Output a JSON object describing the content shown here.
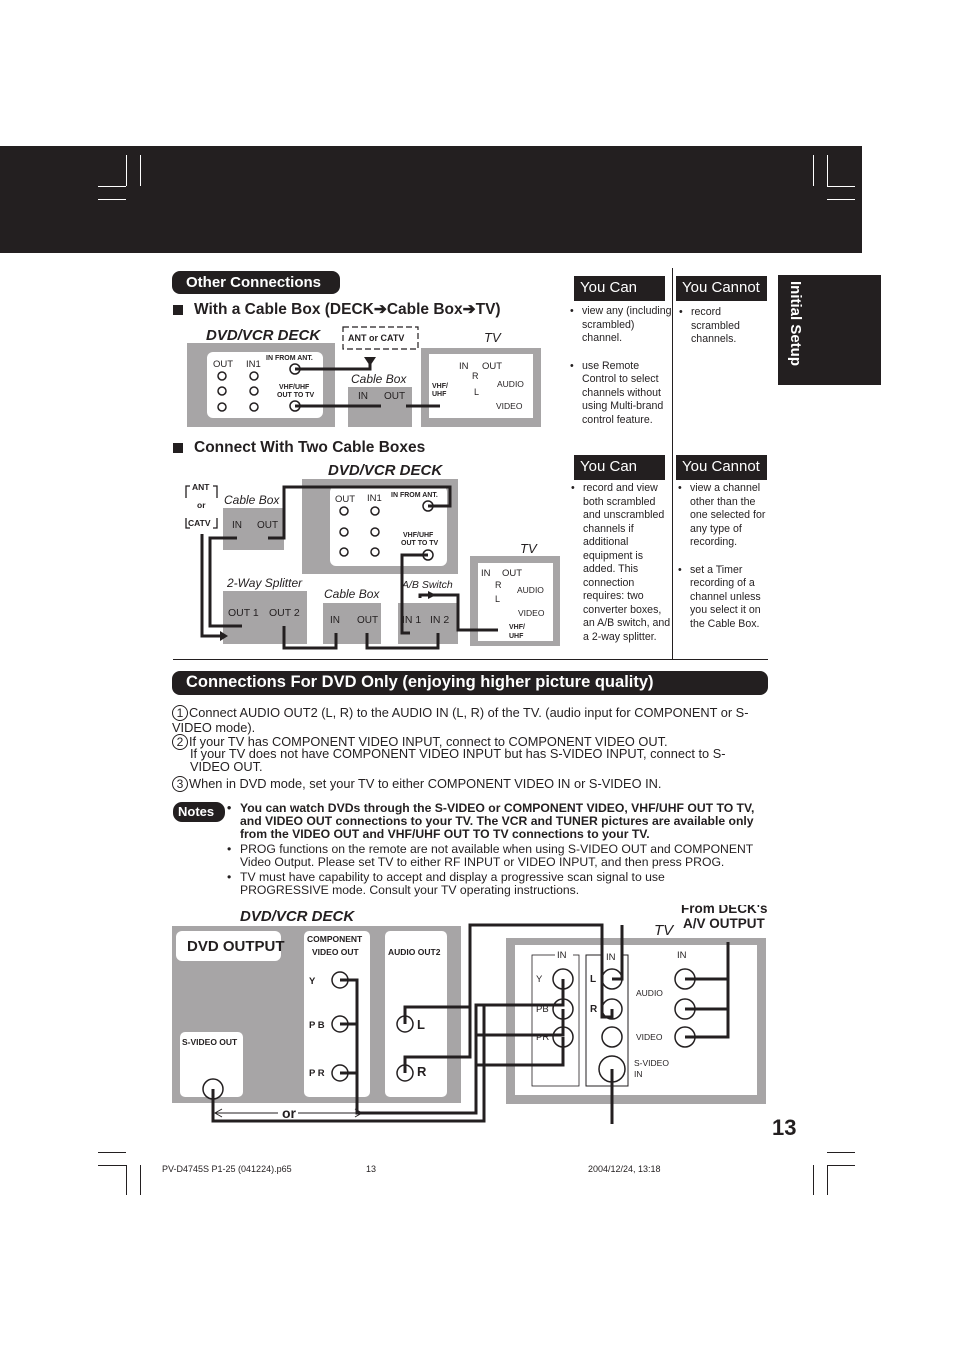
{
  "header": {
    "side_tab": "Initial Setup"
  },
  "section": {
    "title": "Other Connections",
    "cable_box": {
      "heading": "With a Cable Box (DECK➔Cable Box➔TV)",
      "deck_label": "DVD/VCR DECK",
      "tv_label": "TV",
      "ant_label": "ANT or CATV",
      "cable_box_label": "Cable  Box",
      "deck_ports": {
        "out": "OUT",
        "in1": "IN1",
        "in_from_ant": "IN FROM ANT.",
        "vhf_uhf_out_1": "VHF/UHF",
        "vhf_uhf_out_2": "OUT TO TV"
      },
      "cable_ports": {
        "in": "IN",
        "out": "OUT"
      },
      "tv_ports": {
        "vhf": "VHF/",
        "uhf": "UHF",
        "in": "IN",
        "out": "OUT",
        "r": "R",
        "l": "L",
        "audio": "AUDIO",
        "video": "VIDEO"
      },
      "you_can": {
        "title": "You Can",
        "items": [
          "view any (including scrambled) channel.",
          "use Remote Control to select channels without using Multi-brand control feature."
        ]
      },
      "you_cannot": {
        "title": "You Cannot",
        "items": [
          "record scrambled channels."
        ]
      }
    },
    "two_boxes": {
      "heading": "Connect With Two Cable Boxes",
      "deck_label": "DVD/VCR DECK",
      "tv_label": "TV",
      "ant_1": "ANT",
      "ant_2": "or",
      "ant_3": "CATV",
      "cable_box_label": "Cable  Box",
      "splitter_label": "2-Way  Splitter",
      "ab_switch_label": "A/B  Switch",
      "splitter_ports": {
        "out1": "OUT 1",
        "out2": "OUT 2"
      },
      "switch_ports": {
        "in1": "IN 1",
        "in2": "IN 2"
      },
      "you_can": {
        "title": "You Can",
        "items": [
          "record and view both scrambled and unscrambled channels if additional equipment is added. This connection requires: two converter boxes, an A/B switch, and a 2-way splitter."
        ]
      },
      "you_cannot": {
        "title": "You Cannot",
        "items": [
          "view a channel other than the one selected for any type of recording.",
          "set a Timer recording of a channel unless you select it on the Cable Box."
        ]
      }
    }
  },
  "dvd_only": {
    "title": "Connections For DVD Only (enjoying higher picture quality)",
    "steps": [
      {
        "num": "1",
        "text": "Connect AUDIO OUT2 (L, R) to the AUDIO IN (L, R) of the TV. (audio input for COMPONENT or S-VIDEO mode)."
      },
      {
        "num": "2",
        "text": "If your TV has COMPONENT VIDEO INPUT, connect to COMPONENT VIDEO OUT.",
        "text2": "If your TV does not have COMPONENT VIDEO INPUT but has S-VIDEO INPUT, connect to S-VIDEO OUT."
      },
      {
        "num": "3",
        "text": "When in DVD mode, set your TV to either COMPONENT VIDEO IN or S-VIDEO IN."
      }
    ],
    "notes_label": "Notes",
    "notes": [
      "You can watch DVDs through the S-VIDEO or COMPONENT VIDEO, VHF/UHF OUT TO TV, and VIDEO OUT connections to your TV. The VCR and TUNER pictures are available only from the VIDEO OUT and VHF/UHF OUT TO TV connections to your TV.",
      "PROG functions on the remote are not available when using S-VIDEO OUT and COMPONENT Video Output. Please set TV to either RF INPUT or VIDEO INPUT, and then press PROG.",
      "TV must have capability to accept and display a progressive scan signal to use PROGRESSIVE mode. Consult your TV operating instructions."
    ],
    "diagram": {
      "deck_label": "DVD/VCR DECK",
      "tv_label": "TV",
      "dvd_output": "DVD OUTPUT",
      "component_1": "COMPONENT",
      "component_2": "VIDEO OUT",
      "audio_out2": "AUDIO OUT2",
      "y": "Y",
      "pb": "P B",
      "pr": "P R",
      "l": "L",
      "r": "R",
      "svideo_out": "S-VIDEO OUT",
      "or": "or",
      "from_deck_1": "From DECK's",
      "from_deck_2": "A/V OUTPUT",
      "tv_in": "IN",
      "tv_y": "Y",
      "tv_pb": "PB",
      "tv_pr": "PR",
      "tv_l": "L",
      "tv_r": "R",
      "tv_audio": "AUDIO",
      "tv_video": "VIDEO",
      "tv_svideo_1": "S-VIDEO",
      "tv_svideo_2": "IN"
    }
  },
  "page_number": "13",
  "footer": {
    "file": "PV-D4745S P1-25 (041224).p65",
    "page": "13",
    "timestamp": "2004/12/24, 13:18"
  }
}
